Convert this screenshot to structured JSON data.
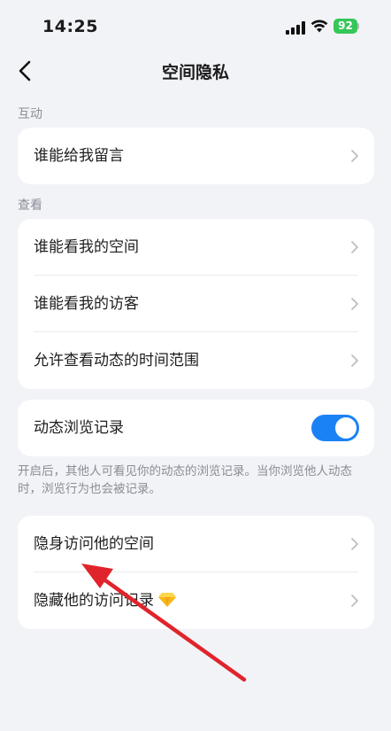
{
  "status_bar": {
    "time": "14:25",
    "battery_level": "92",
    "battery_color": "#35c759"
  },
  "nav": {
    "title": "空间隐私"
  },
  "sections": {
    "interaction": {
      "label": "互动",
      "items": [
        {
          "label": "谁能给我留言"
        }
      ]
    },
    "view": {
      "label": "查看",
      "items": [
        {
          "label": "谁能看我的空间"
        },
        {
          "label": "谁能看我的访客"
        },
        {
          "label": "允许查看动态的时间范围"
        }
      ]
    },
    "browse_record": {
      "label": "动态浏览记录",
      "enabled": true,
      "toggle_color": "#1b82f5",
      "note": "开启后，其他人可看见你的动态的浏览记录。当你浏览他人动态时，浏览行为也会被记录。"
    },
    "stealth": {
      "items": [
        {
          "label": "隐身访问他的空间"
        },
        {
          "label": "隐藏他的访问记录",
          "icon": "diamond-icon"
        }
      ]
    }
  },
  "annotation": {
    "arrow_color": "#e0242b"
  }
}
